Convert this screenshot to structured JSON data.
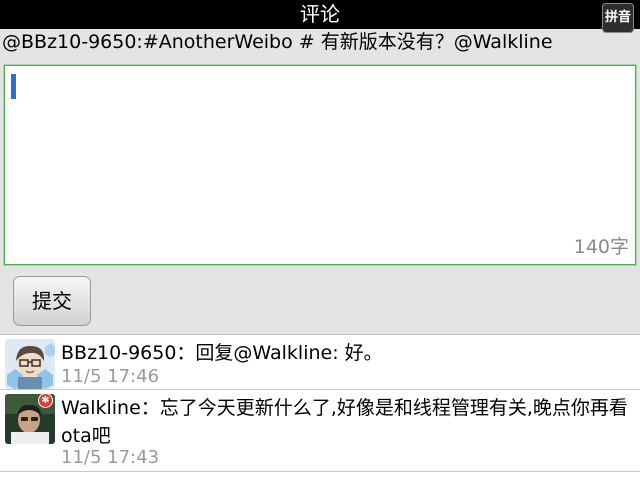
{
  "header": {
    "title": "评论",
    "ime_label": "拼音"
  },
  "context_line": "@BBz10-9650:#AnotherWeibo # 有新版本没有？@Walkline",
  "editor": {
    "value": "",
    "char_counter": "140字"
  },
  "submit_label": "提交",
  "comments": [
    {
      "text": "BBz10-9650：回复@Walkline: 好。",
      "time": "11/5 17:46"
    },
    {
      "text": "Walkline：忘了今天更新什么了,好像是和线程管理有关,晚点你再看ota吧",
      "time": "11/5 17:43"
    }
  ],
  "colors": {
    "editor_border": "#4caf50",
    "cursor": "#2f6fd0",
    "timestamp": "#9a9a9a",
    "badge": "#e53935"
  }
}
